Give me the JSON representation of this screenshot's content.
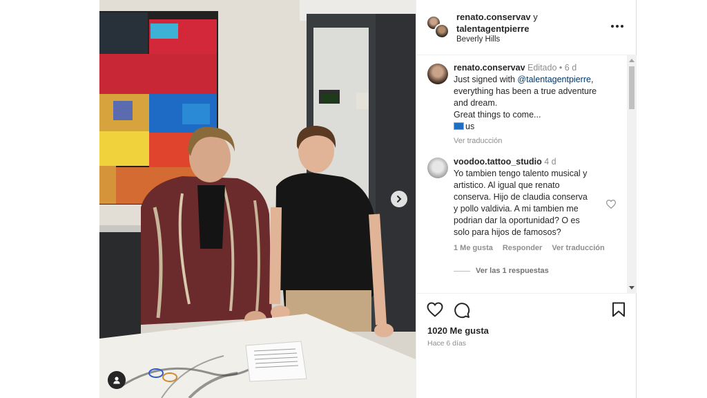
{
  "post": {
    "author1": "renato.conservav",
    "conjunction": "y",
    "author2": "talentagentpierre",
    "location": "Beverly Hills",
    "more_icon": "more-horizontal-icon"
  },
  "comments": [
    {
      "user": "renato.conservav",
      "edited": "Editado",
      "dot": "•",
      "time": "6 d",
      "lines": [
        "Just signed with ",
        "@talentagentpierre",
        ",",
        "everything has been a true adventure",
        "and dream.",
        "Great things to come..."
      ],
      "flag_text": "us",
      "translate": "Ver traducción"
    },
    {
      "user": "voodoo.tattoo_studio",
      "time": "4 d",
      "lines": [
        "Yo tambien tengo talento musical y",
        "artistico. Al igual que renato",
        "conserva. Hijo de claudia conserva",
        "y pollo valdivia. A mi tambien me",
        "podrian dar la oportunidad? O es",
        "solo para hijos de famosos?"
      ],
      "likes": "1 Me gusta",
      "reply": "Responder",
      "translate": "Ver traducción",
      "view_replies": "Ver las 1 respuestas"
    }
  ],
  "footer": {
    "likes": "1020 Me gusta",
    "time": "Hace 6 días",
    "icons": [
      "heart-icon",
      "comment-icon",
      "bookmark-icon"
    ]
  },
  "colors": {
    "text": "#262626",
    "muted": "#8e8e8e",
    "link": "#00376b",
    "divider": "#efefef"
  }
}
